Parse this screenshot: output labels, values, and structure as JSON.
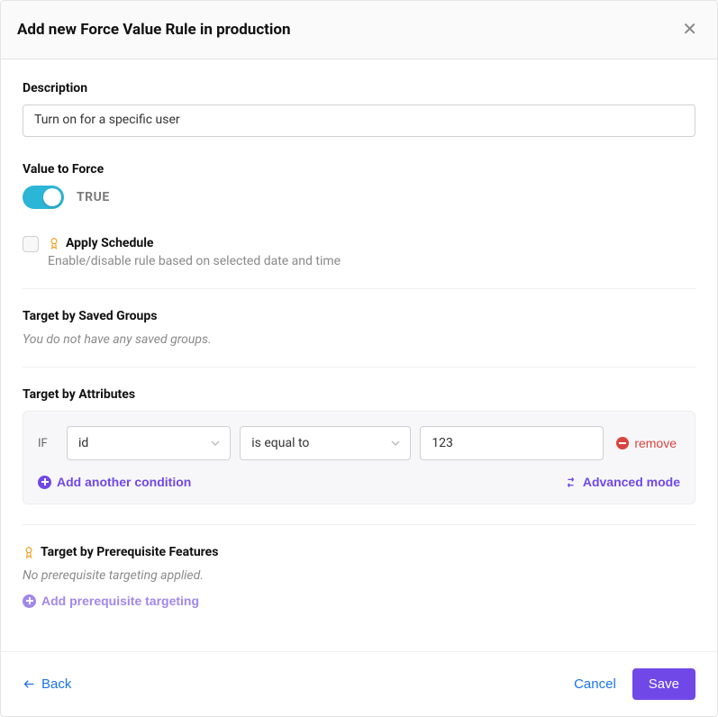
{
  "header": {
    "title": "Add new Force Value Rule in production"
  },
  "description": {
    "label": "Description",
    "value": "Turn on for a specific user"
  },
  "valueToForce": {
    "label": "Value to Force",
    "state": "TRUE"
  },
  "schedule": {
    "label": "Apply Schedule",
    "sub": "Enable/disable rule based on selected date and time"
  },
  "savedGroups": {
    "label": "Target by Saved Groups",
    "empty": "You do not have any saved groups."
  },
  "attributes": {
    "label": "Target by Attributes",
    "if": "IF",
    "condition": {
      "attribute": "id",
      "operator": "is equal to",
      "value": "123"
    },
    "remove": "remove",
    "addCondition": "Add another condition",
    "advanced": "Advanced mode"
  },
  "prerequisite": {
    "label": "Target by Prerequisite Features",
    "empty": "No prerequisite targeting applied.",
    "add": "Add prerequisite targeting"
  },
  "footer": {
    "back": "Back",
    "cancel": "Cancel",
    "save": "Save"
  }
}
